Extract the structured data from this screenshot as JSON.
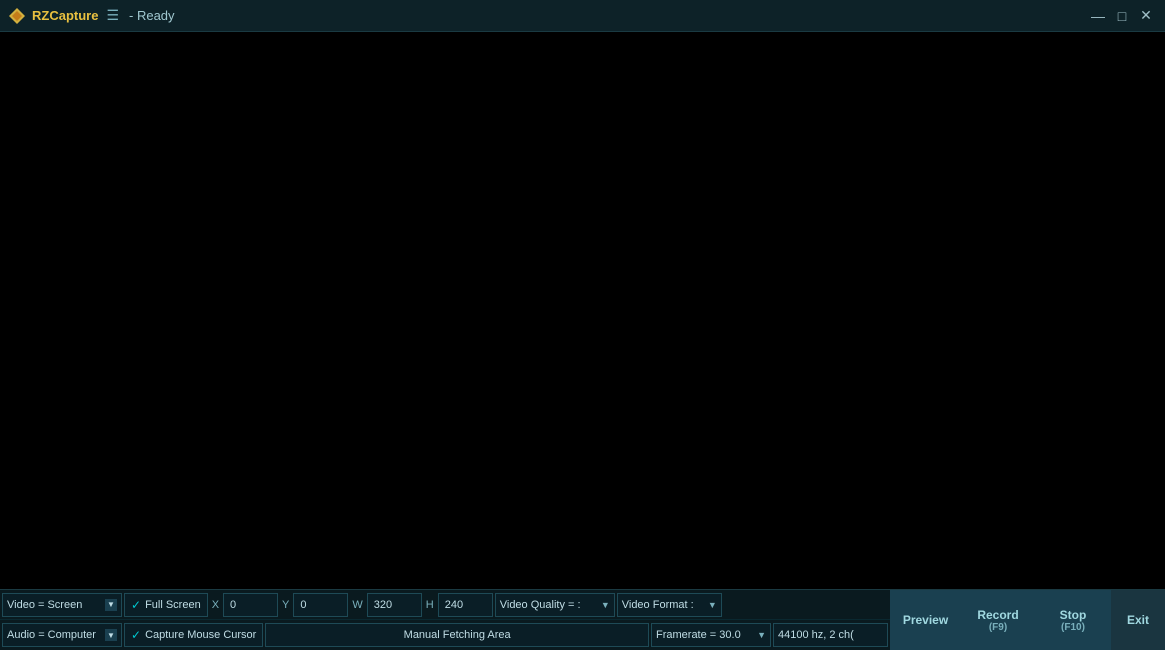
{
  "titlebar": {
    "app_name": "RZCapture",
    "separator": "☰",
    "status": "- Ready",
    "win_minimize": "—",
    "win_maximize": "□",
    "win_close": "✕"
  },
  "controls": {
    "row1": {
      "video_source": "Video = Screen",
      "fullscreen_checked": "✓",
      "fullscreen_label": "Full Screen",
      "x_label": "X",
      "x_value": "0",
      "y_label": "Y",
      "y_value": "0",
      "w_label": "W",
      "w_value": "320",
      "h_label": "H",
      "h_value": "240",
      "video_quality_label": "Video Quality = :",
      "video_format_label": "Video Format :"
    },
    "row2": {
      "audio_source": "Audio = Computer",
      "cursor_checked": "✓",
      "cursor_label": "Capture Mouse Cursor",
      "manual_fetch_label": "Manual Fetching Area",
      "framerate_label": "Framerate = 30.0",
      "audio_info": "44100 hz, 2 ch("
    },
    "buttons": {
      "preview": "Preview",
      "record": "Record",
      "record_shortcut": "(F9)",
      "stop": "Stop",
      "stop_shortcut": "(F10)",
      "exit": "Exit"
    }
  },
  "colors": {
    "bg_dark": "#000000",
    "titlebar_bg": "#0d2228",
    "controls_bg": "#0d2228",
    "field_bg": "#0a1e26",
    "border": "#1e4a56",
    "accent": "#00c8d0",
    "text_primary": "#c0dde5",
    "text_secondary": "#7ab0bc",
    "btn_bg": "#1a4050"
  }
}
